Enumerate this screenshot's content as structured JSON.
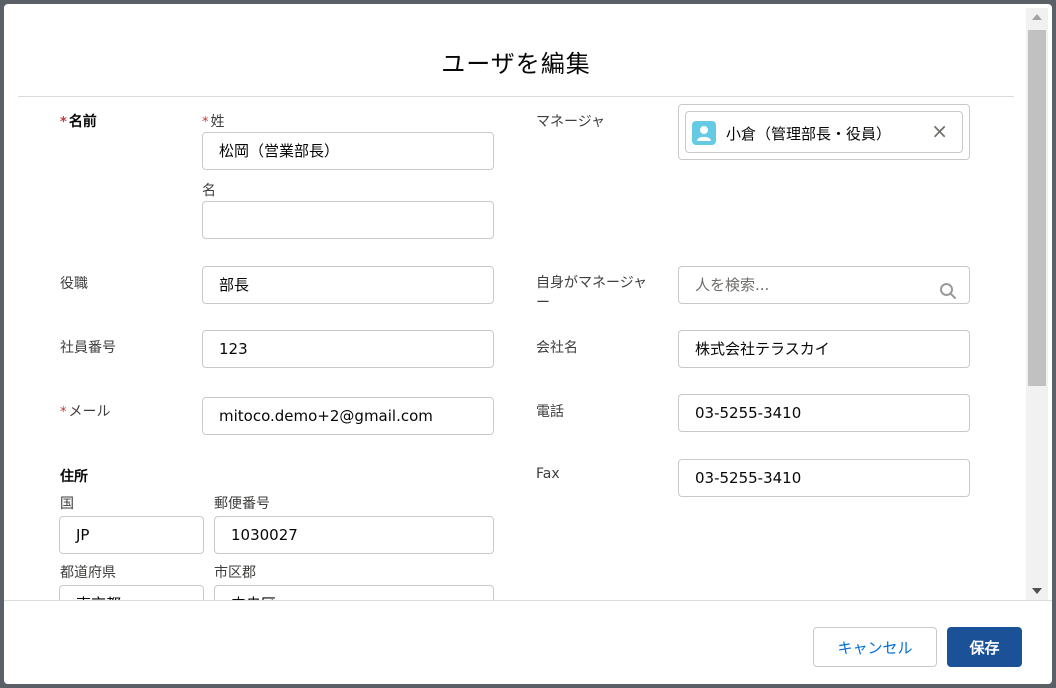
{
  "modal": {
    "title": "ユーザを編集"
  },
  "required_mark": "*",
  "fields": {
    "name_label": "名前",
    "last_name_label": "姓",
    "last_name_value": "松岡（営業部長）",
    "first_name_label": "名",
    "first_name_value": "",
    "title_label": "役職",
    "title_value": "部長",
    "employee_number_label": "社員番号",
    "employee_number_value": "123",
    "email_label": "メール",
    "email_value": "mitoco.demo+2@gmail.com",
    "address_label": "住所",
    "country_label": "国",
    "country_value": "JP",
    "postal_label": "郵便番号",
    "postal_value": "1030027",
    "state_label": "都道府県",
    "state_value": "東京都",
    "city_label": "市区郡",
    "city_value": "中央区",
    "manager_label": "マネージャ",
    "manager_value": "小倉（管理部長・役員）",
    "delegated_label_line1": "自身がマネージャ",
    "delegated_label_line2": "ー",
    "delegated_placeholder": "人を検索...",
    "company_label": "会社名",
    "company_value": "株式会社テラスカイ",
    "phone_label": "電話",
    "phone_value": "03-5255-3410",
    "fax_label": "Fax",
    "fax_value": "03-5255-3410"
  },
  "icons": {
    "user_avatar": "user-icon",
    "clear": "close-icon",
    "search": "search-icon"
  },
  "footer": {
    "cancel_label": "キャンセル",
    "save_label": "保存"
  },
  "colors": {
    "primary_button": "#1b5297",
    "link": "#0070d2",
    "required": "#c23934",
    "avatar": "#65cae4"
  }
}
